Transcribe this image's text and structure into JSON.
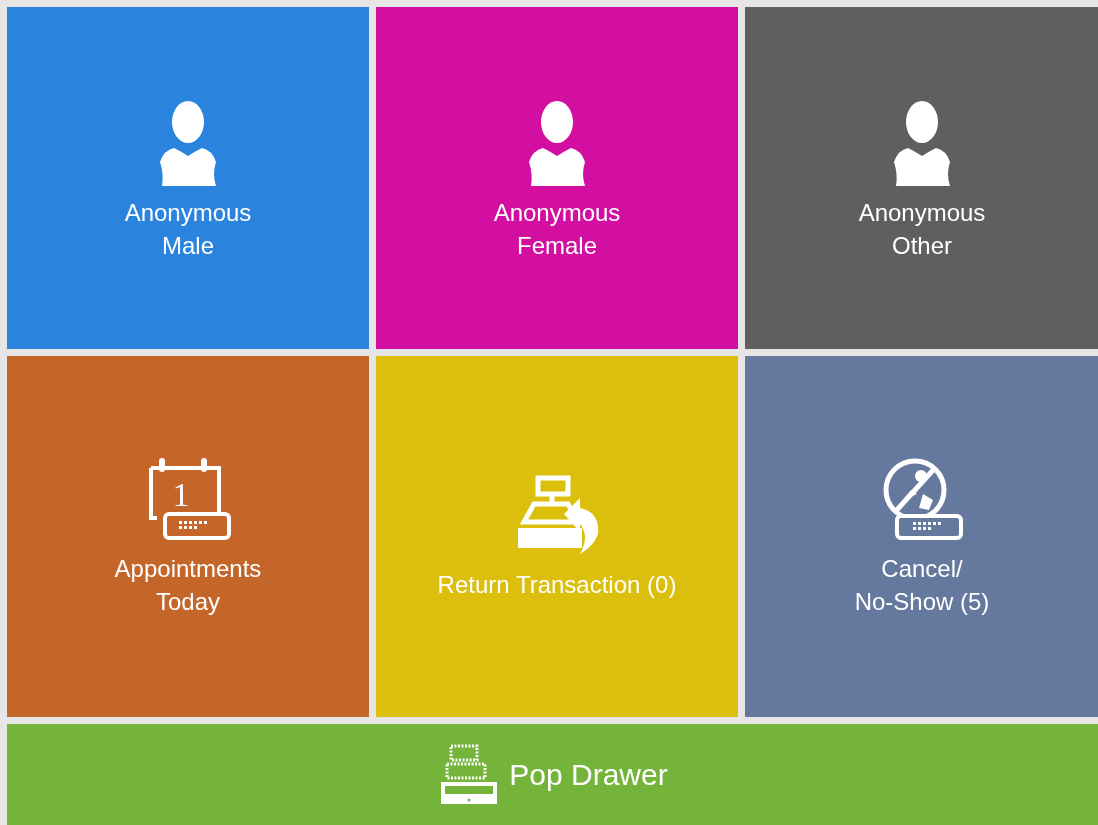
{
  "tiles": [
    {
      "kind": "person",
      "label_lines": [
        "Anonymous",
        "Male"
      ],
      "color": "#2a84de"
    },
    {
      "kind": "person",
      "label_lines": [
        "Anonymous",
        "Female"
      ],
      "color": "#d20fa0"
    },
    {
      "kind": "person",
      "label_lines": [
        "Anonymous",
        "Other"
      ],
      "color": "#5f5f5f"
    },
    {
      "kind": "calendar",
      "label_lines": [
        "Appointments",
        "Today"
      ],
      "color": "#c4652a",
      "icon_text": "1"
    },
    {
      "kind": "return",
      "label_lines": [
        "Return Transaction (0)"
      ],
      "color": "#dbbf0c"
    },
    {
      "kind": "cancel",
      "label_lines": [
        "Cancel/",
        "No-Show (5)"
      ],
      "color": "#65799e"
    }
  ],
  "footer": {
    "kind": "drawer",
    "label": "Pop Drawer",
    "color": "#74b43a"
  }
}
